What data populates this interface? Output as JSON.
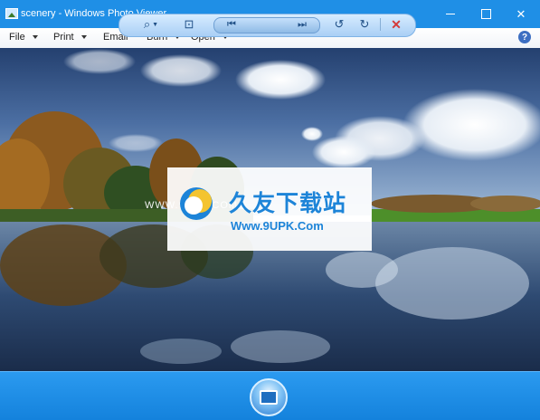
{
  "window": {
    "title": "scenery - Windows Photo Viewer",
    "controls": {
      "minimize": "minimize",
      "maximize": "maximize",
      "close": "close"
    }
  },
  "menu": {
    "items": [
      {
        "label": "File",
        "has_arrow": true
      },
      {
        "label": "Print",
        "has_arrow": true
      },
      {
        "label": "Email",
        "has_arrow": false
      },
      {
        "label": "Burn",
        "has_arrow": true
      },
      {
        "label": "Open",
        "has_arrow": true
      }
    ],
    "help_glyph": "?"
  },
  "photo": {
    "name": "scenery",
    "watermark": {
      "chinese_text": "久友下载站",
      "url_text": "Www.9UPK.Com",
      "side_text": "WWW.9UPK.COM"
    }
  },
  "toolbar": {
    "icons": [
      "zoom-icon",
      "fit-window-icon",
      "previous-icon",
      "slideshow-icon",
      "next-icon",
      "rotate-counterclockwise-icon",
      "rotate-clockwise-icon",
      "delete-icon"
    ],
    "zoom_glyph": "⌕",
    "fit_glyph": "⊡",
    "prev_glyph": "⏮",
    "next_glyph": "⏭",
    "rotate_left_glyph": "↺",
    "rotate_right_glyph": "↻",
    "delete_glyph": "✕"
  },
  "colors": {
    "titlebar": "#1f8fe6",
    "toolbar": "#1482dc",
    "watermark_blue": "#1d84d8",
    "delete_red": "#d43a3a"
  }
}
